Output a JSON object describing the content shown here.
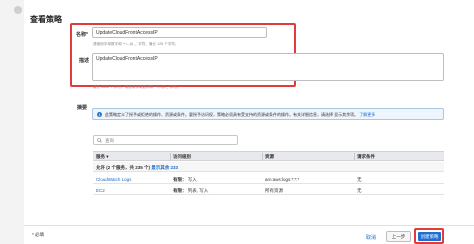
{
  "page": {
    "title": "查看策略"
  },
  "form": {
    "name_label": "名称*",
    "name_value": "UpdateCloudFrontAccessIP",
    "name_help": "请使用字母数字和 '+=,.@-_' 字符。最长 128 个字符。",
    "description_label": "描述",
    "description_value": "UpdateCloudFrontAccessIP",
    "description_help": "最长 1000 个字符。请使用字母数字和 '+=,.@-_' 字符。"
  },
  "summary": {
    "label": "摘要",
    "info_text": "此策略定义了授予或拒绝的操作、资源或条件。要授予访问权，策略必须具有受支持的资源或条件的操作。有关详细信息，请选择 显示其余项。",
    "info_link": "了解更多",
    "search_placeholder": "查询",
    "columns": [
      "服务 ▾",
      "访问级别",
      "资源",
      "请求条件"
    ],
    "allow_row": {
      "text": "允许 (2 个服务，共 235 个)",
      "link": "显示其余 233"
    },
    "rows": [
      {
        "service": "CloudWatch Logs",
        "access_prefix": "有限：",
        "access": "写入",
        "resource": "arn:aws:logs:*:*:*",
        "condition": "无"
      },
      {
        "service": "EC2",
        "access_prefix": "有限：",
        "access": "列表, 写入",
        "resource": "所有资源",
        "condition": "无"
      }
    ]
  },
  "footer": {
    "required": "* 必填",
    "cancel": "取消",
    "previous": "上一步",
    "create": "创建策略"
  }
}
